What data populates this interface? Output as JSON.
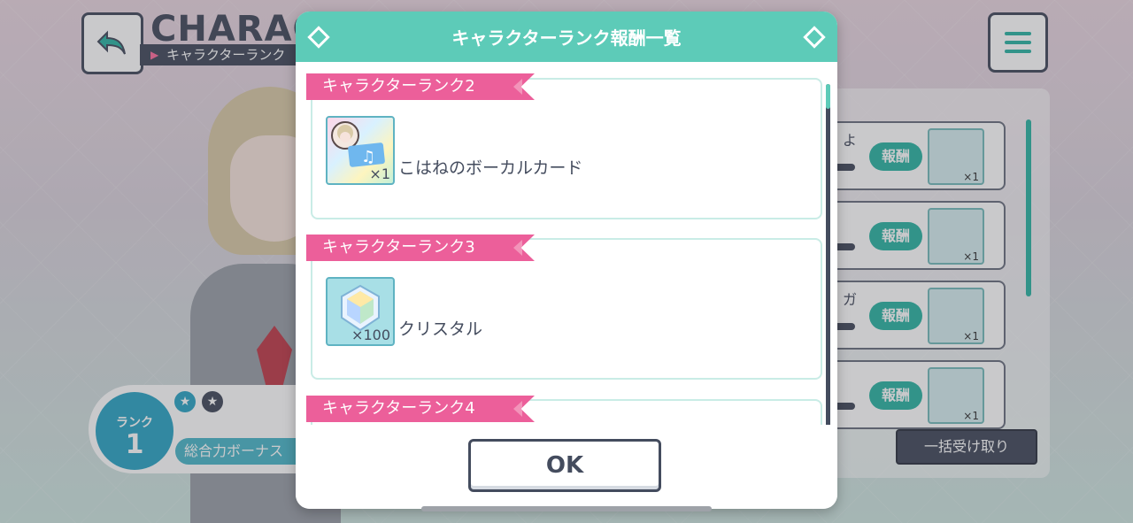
{
  "background": {
    "title": "CHARACT",
    "subtitle": "キャラクターランク",
    "rank_label": "ランク",
    "rank_value": "1",
    "bonus_text": "総合力ボーナス",
    "missions": [
      {
        "text": "よ",
        "reward_label": "報酬",
        "count": "×1"
      },
      {
        "text": "",
        "reward_label": "報酬",
        "count": "×1"
      },
      {
        "text": "ガ",
        "reward_label": "報酬",
        "count": "×1"
      },
      {
        "text": "",
        "reward_label": "報酬",
        "count": "×1"
      }
    ],
    "claim_all_label": "一括受け取り"
  },
  "modal": {
    "title": "キャラクターランク報酬一覧",
    "ok_label": "OK",
    "ranks": [
      {
        "header": "キャラクターランク2",
        "item_name": "こはねのボーカルカード",
        "count": "×1",
        "icon": "vocal-card-icon"
      },
      {
        "header": "キャラクターランク3",
        "item_name": "クリスタル",
        "count": "×100",
        "icon": "crystal-icon"
      },
      {
        "header": "キャラクターランク4",
        "item_name": "",
        "count": "",
        "icon": ""
      }
    ]
  },
  "colors": {
    "accent": "#5dcbb8",
    "header_pink": "#ec5f9a",
    "text_dark": "#444c5e"
  }
}
